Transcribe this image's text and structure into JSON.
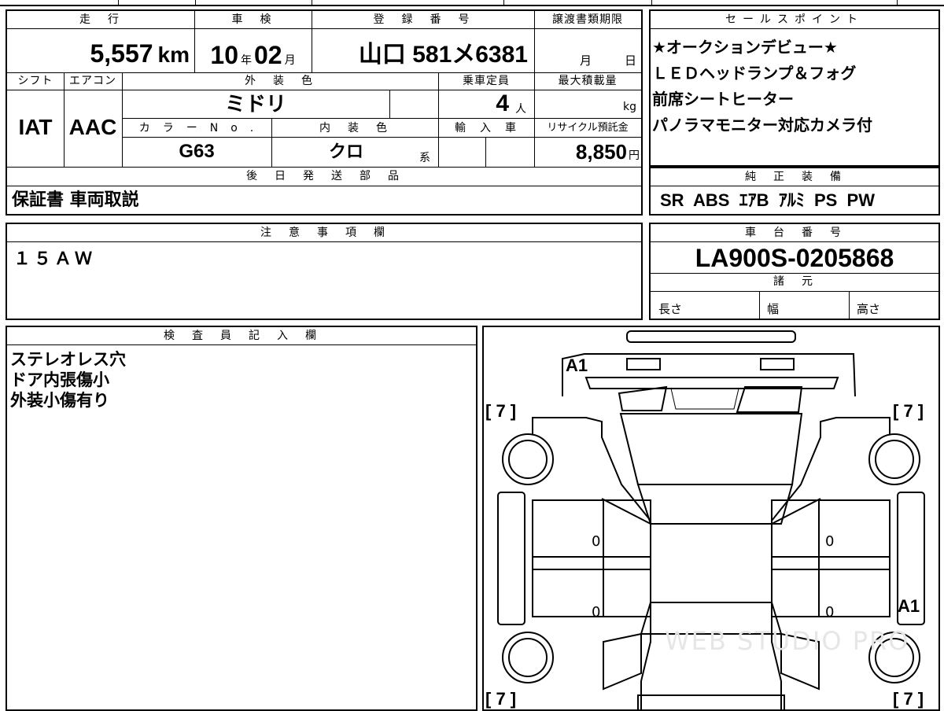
{
  "top_strip": {
    "fragment_1": "国",
    "fragment_2": "月",
    "fragment_3": "J"
  },
  "main_table": {
    "headers": {
      "mileage": "走　行",
      "inspection": "車　検",
      "registration": "登　録　番　号",
      "transfer_deadline": "譲渡書類期限",
      "shift": "シフト",
      "aircon": "エアコン",
      "exterior_color": "外　装　色",
      "capacity": "乗車定員",
      "max_load": "最大積載量",
      "color_no": "カ　ラ　ー　N　o　.",
      "interior_color": "内　装　色",
      "import": "輸　入　車",
      "recycle": "リサイクル預託金"
    },
    "values": {
      "mileage": "5,557",
      "mileage_unit": "km",
      "inspection_year": "10",
      "inspection_year_unit": "年",
      "inspection_month": "02",
      "inspection_month_unit": "月",
      "registration": "山口 581メ6381",
      "transfer_month_unit": "月",
      "transfer_day_unit": "日",
      "shift": "IAT",
      "aircon": "AAC",
      "exterior_color": "ミドリ",
      "capacity": "4",
      "capacity_unit": "人",
      "max_load_unit": "kg",
      "color_no": "G63",
      "interior_color": "クロ",
      "interior_color_suffix": "系",
      "recycle": "8,850",
      "recycle_unit": "円"
    }
  },
  "sales_points": {
    "header": "セールスポイント",
    "lines": [
      "★オークションデビュー★",
      "ＬＥＤヘッドランプ＆フォグ",
      "前席シートヒーター",
      "パノラマモニター対応カメラ付"
    ]
  },
  "later_parts": {
    "header": "後　日　発　送　部　品",
    "value": "保証書 車両取説"
  },
  "genuine_equipment": {
    "header": "純　正　装　備",
    "value": "SR  ABS  ｴｱB  ｱﾙﾐ  PS  PW"
  },
  "notes": {
    "header": "注　意　事　項　欄",
    "value": "１５ＡＷ"
  },
  "chassis": {
    "header": "車　台　番　号",
    "value": "LA900S-0205868"
  },
  "specs": {
    "header": "諸　元",
    "length": "長さ",
    "width": "幅",
    "height": "高さ"
  },
  "inspector": {
    "header": "検　査　員　記　入　欄",
    "lines": [
      "ステレオレス穴",
      "ドア内張傷小",
      "外装小傷有り"
    ]
  },
  "diagram": {
    "marks": {
      "top_left": "A1",
      "right": "A1",
      "tread_fl": "[ 7 ]",
      "tread_fr": "[ 7 ]",
      "tread_rl": "[ 7 ]",
      "tread_rr": "[ 7 ]",
      "door_l1": "0",
      "door_l2": "0",
      "door_r1": "0",
      "door_r2": "0"
    },
    "watermark": "WEB STUDIO PRO"
  }
}
